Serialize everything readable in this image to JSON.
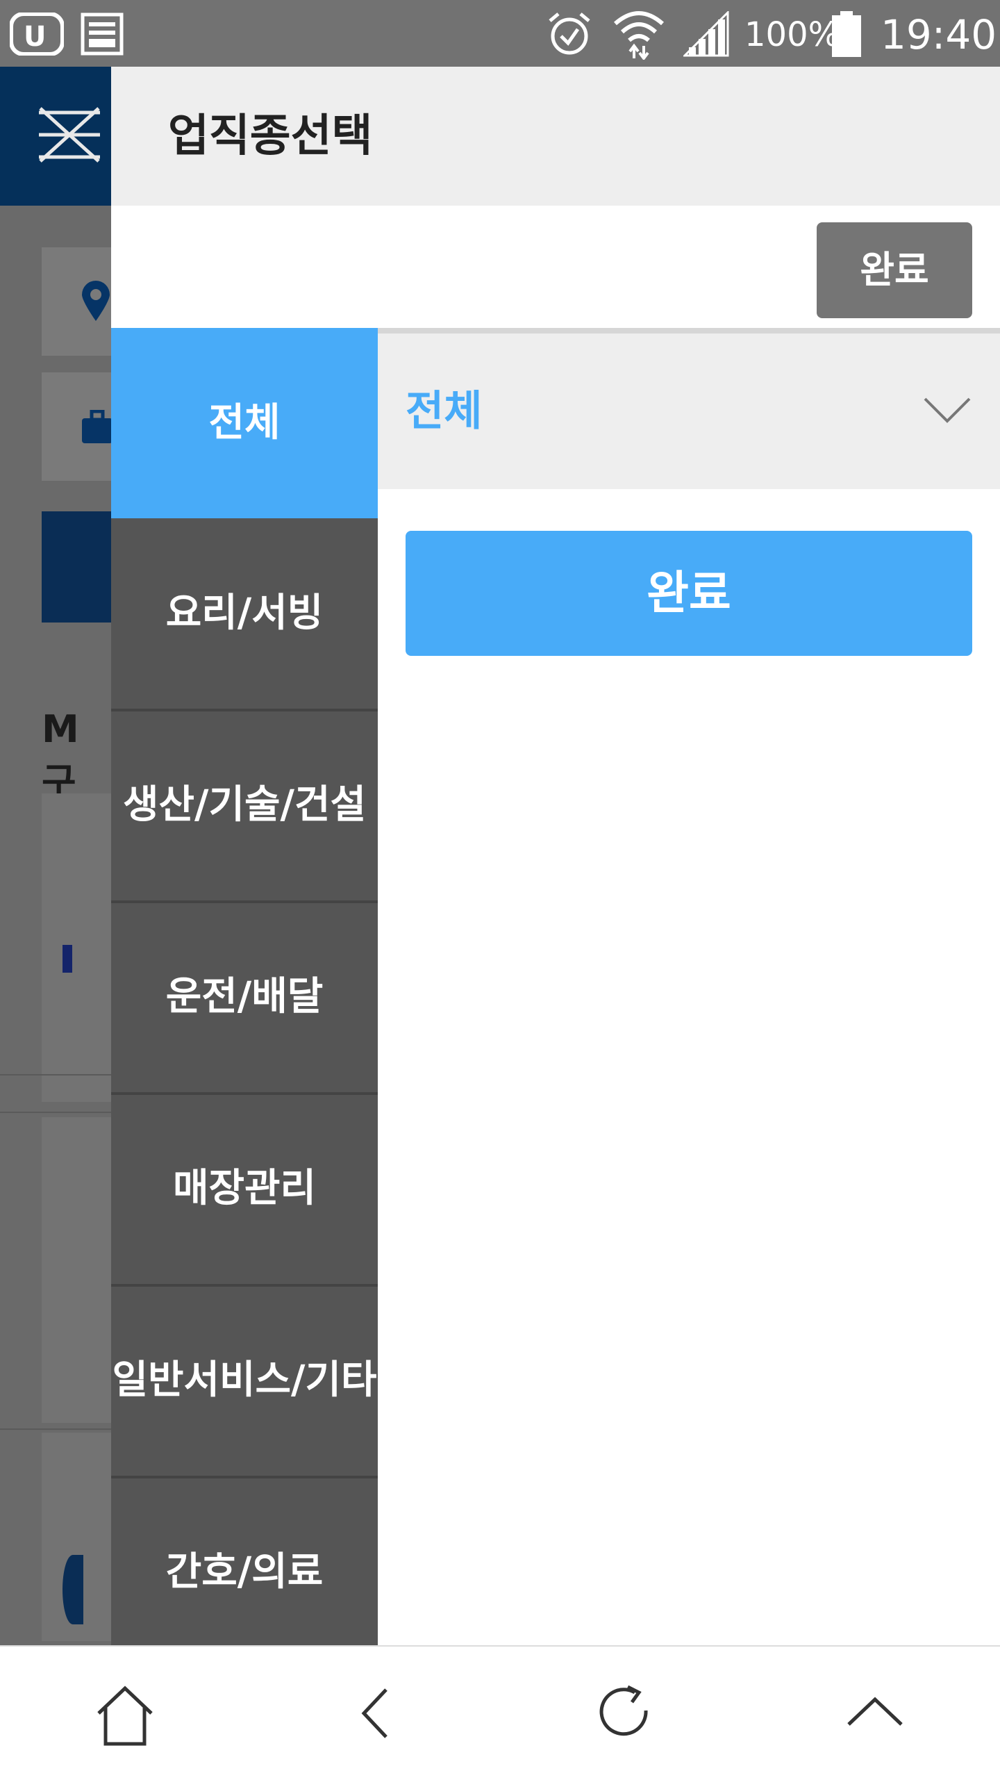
{
  "status_bar": {
    "battery": "100%",
    "time": "19:40",
    "icons": [
      "uplus-app-icon",
      "calendar-app-icon",
      "alarm-icon",
      "wifi-icon",
      "signal-icon",
      "battery-icon"
    ]
  },
  "background_page": {
    "label_partial": "M구"
  },
  "drawer": {
    "title": "업직종선택",
    "top_done_label": "완료",
    "categories": [
      {
        "label": "전체",
        "active": true
      },
      {
        "label": "요리/서빙",
        "active": false
      },
      {
        "label": "생산/기술/건설",
        "active": false
      },
      {
        "label": "운전/배달",
        "active": false
      },
      {
        "label": "매장관리",
        "active": false
      },
      {
        "label": "일반서비스/기타",
        "active": false
      },
      {
        "label": "간호/의료",
        "active": false
      }
    ],
    "subcategory_selected": "전체",
    "done_button_label": "완료"
  },
  "bottom_nav": {
    "icons": [
      "home-icon",
      "back-icon",
      "refresh-icon",
      "scroll-up-icon"
    ]
  },
  "colors": {
    "accent": "#48abf8",
    "category_bg": "#555555",
    "header_bg": "#eeeeee",
    "status_bar": "#727272",
    "navy": "#05305a"
  }
}
